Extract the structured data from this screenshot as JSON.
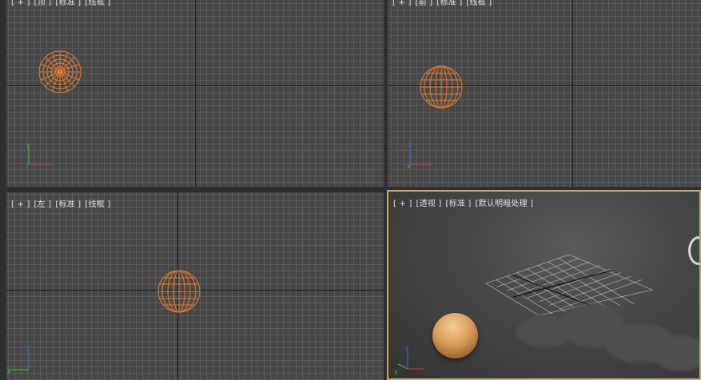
{
  "viewports": {
    "top": {
      "labels": [
        "[ + ]",
        "[顶 ]",
        "[标准 ]",
        "[线框 ]"
      ]
    },
    "front": {
      "labels": [
        "[ + ]",
        "[前 ]",
        "[标准 ]",
        "[线框 ]"
      ]
    },
    "left": {
      "labels": [
        "[ + ]",
        "[左 ]",
        "[标准 ]",
        "[线框 ]"
      ]
    },
    "perspective": {
      "labels": [
        "[ + ]",
        "[透视 ]",
        "[标准 ]",
        "[默认明暗处理 ]"
      ]
    }
  },
  "colors": {
    "sphere_wire": "#e07a30",
    "sphere_shaded": "#d99b5a",
    "axis_x": "#d23c3c",
    "axis_y": "#3cc83c",
    "axis_z": "#4a64e0",
    "active_viewport_border": "#c9a86a"
  },
  "icons": [
    "axis-tripod-icon"
  ]
}
